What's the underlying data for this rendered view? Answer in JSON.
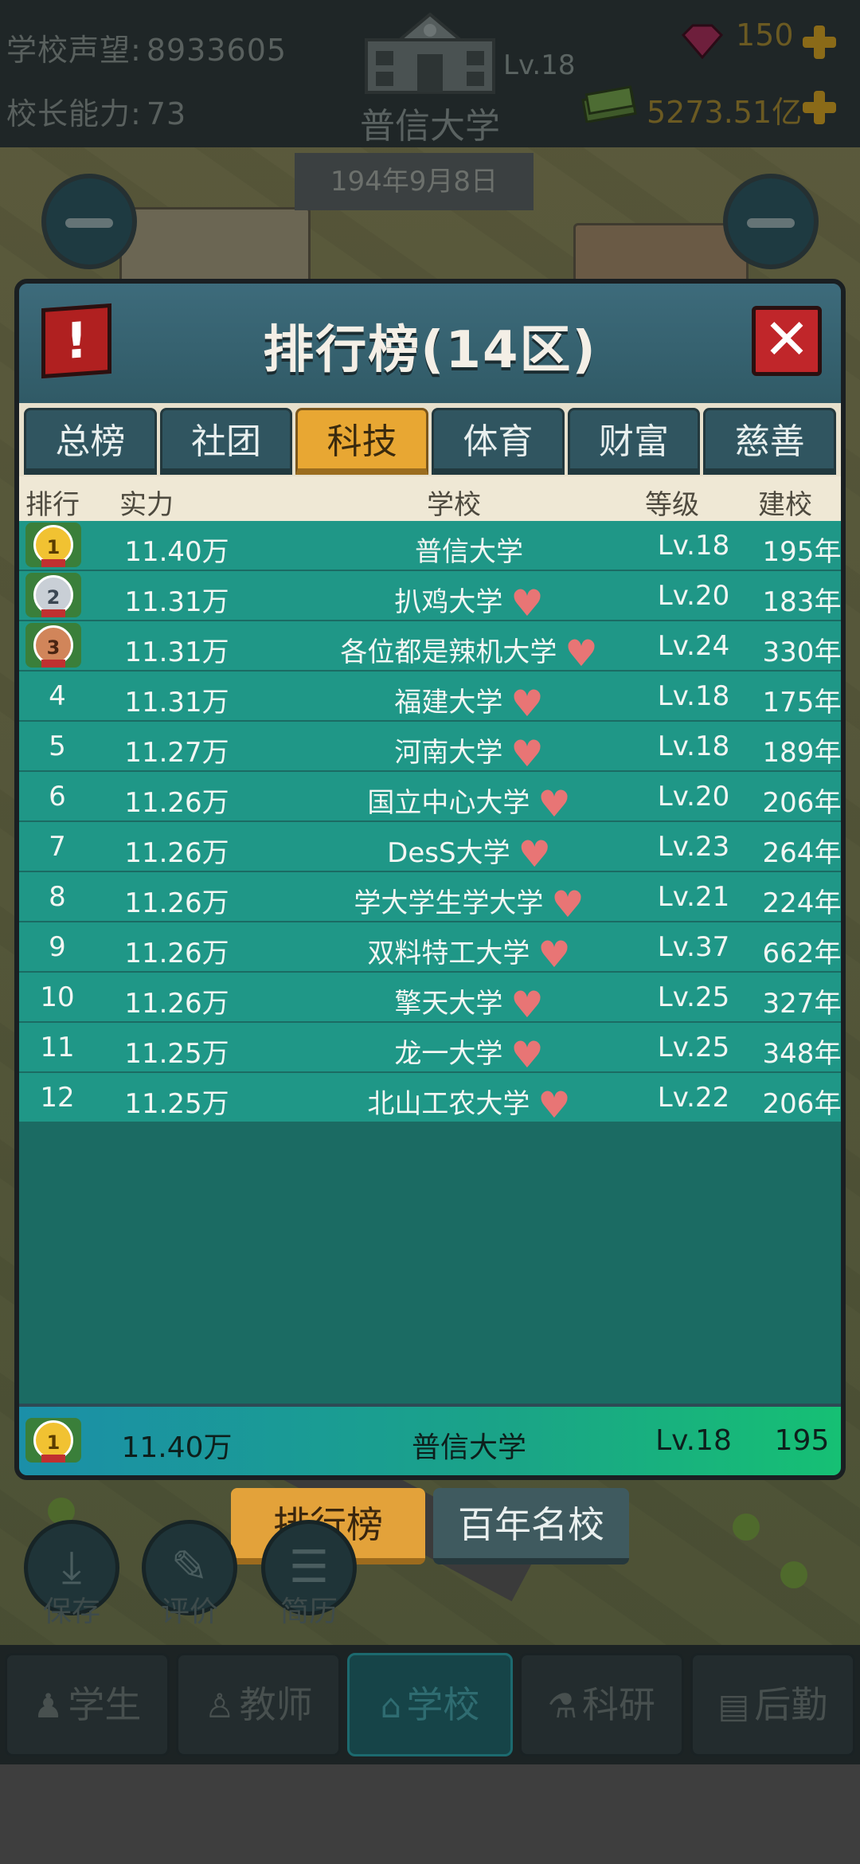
{
  "hud": {
    "reputation_label": "学校声望:",
    "reputation_value": "8933605",
    "ability_label": "校长能力:",
    "ability_value": "73",
    "school_level": "Lv.18",
    "school_name": "普信大学",
    "gems": "150",
    "money": "5273.51亿",
    "date": "194年9月8日"
  },
  "panel": {
    "title": "排行榜(14区)",
    "alert_icon": "!",
    "close_icon": "✕",
    "tabs": [
      {
        "label": "总榜"
      },
      {
        "label": "社团"
      },
      {
        "label": "科技",
        "active": true
      },
      {
        "label": "体育"
      },
      {
        "label": "财富"
      },
      {
        "label": "慈善"
      }
    ],
    "columns": {
      "rank": "排行",
      "power": "实力",
      "school": "学校",
      "level": "等级",
      "founded": "建校"
    },
    "rows": [
      {
        "rank": "1",
        "medal": "gold",
        "power": "11.40万",
        "school": "普信大学",
        "heart": false,
        "level": "Lv.18",
        "founded": "195年"
      },
      {
        "rank": "2",
        "medal": "silver",
        "power": "11.31万",
        "school": "扒鸡大学",
        "heart": true,
        "level": "Lv.20",
        "founded": "183年"
      },
      {
        "rank": "3",
        "medal": "bronze",
        "power": "11.31万",
        "school": "各位都是辣机大学",
        "heart": true,
        "level": "Lv.24",
        "founded": "330年"
      },
      {
        "rank": "4",
        "power": "11.31万",
        "school": "福建大学",
        "heart": true,
        "level": "Lv.18",
        "founded": "175年"
      },
      {
        "rank": "5",
        "power": "11.27万",
        "school": "河南大学",
        "heart": true,
        "level": "Lv.18",
        "founded": "189年"
      },
      {
        "rank": "6",
        "power": "11.26万",
        "school": "国立中心大学",
        "heart": true,
        "level": "Lv.20",
        "founded": "206年"
      },
      {
        "rank": "7",
        "power": "11.26万",
        "school": "DesS大学",
        "heart": true,
        "level": "Lv.23",
        "founded": "264年"
      },
      {
        "rank": "8",
        "power": "11.26万",
        "school": "学大学生学大学",
        "heart": true,
        "level": "Lv.21",
        "founded": "224年"
      },
      {
        "rank": "9",
        "power": "11.26万",
        "school": "双料特工大学",
        "heart": true,
        "level": "Lv.37",
        "founded": "662年"
      },
      {
        "rank": "10",
        "power": "11.26万",
        "school": "擎天大学",
        "heart": true,
        "level": "Lv.25",
        "founded": "327年"
      },
      {
        "rank": "11",
        "power": "11.25万",
        "school": "龙一大学",
        "heart": true,
        "level": "Lv.25",
        "founded": "348年"
      },
      {
        "rank": "12",
        "power": "11.25万",
        "school": "北山工农大学",
        "heart": true,
        "level": "Lv.22",
        "founded": "206年"
      }
    ],
    "self_row": {
      "rank": "1",
      "power": "11.40万",
      "school": "普信大学",
      "level": "Lv.18",
      "founded": "195"
    }
  },
  "buttons": {
    "rank_label": "排行榜",
    "century_label": "百年名校",
    "save_label": "保存",
    "review_label": "评价",
    "resume_label": "简历"
  },
  "nav": [
    {
      "label": "学生",
      "icon": "student-icon",
      "active": false
    },
    {
      "label": "教师",
      "icon": "teacher-icon",
      "active": false
    },
    {
      "label": "学校",
      "icon": "school-icon",
      "active": true
    },
    {
      "label": "科研",
      "icon": "flask-icon",
      "active": false
    },
    {
      "label": "后勤",
      "icon": "clipboard-icon",
      "active": false
    }
  ],
  "colors": {
    "row_bg": "#1f9787",
    "active_tab": "#e8a733",
    "heart": "#e87575",
    "panel_header": "#3d6b7b"
  }
}
